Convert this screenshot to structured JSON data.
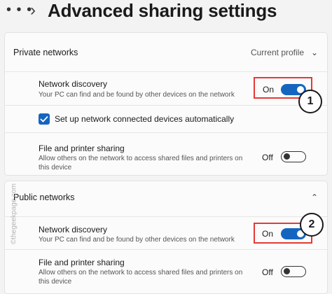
{
  "header": {
    "menu_label": "• • •",
    "title": "Advanced sharing settings"
  },
  "private": {
    "label": "Private networks",
    "profile": "Current profile",
    "discovery_title": "Network discovery",
    "discovery_desc": "Your PC can find and be found by other devices on the network",
    "discovery_state": "On",
    "auto_setup_label": "Set up network connected devices automatically",
    "auto_setup_checked": true,
    "sharing_title": "File and printer sharing",
    "sharing_desc": "Allow others on the network to access shared files and printers on this device",
    "sharing_state": "Off"
  },
  "public": {
    "label": "Public networks",
    "discovery_title": "Network discovery",
    "discovery_desc": "Your PC can find and be found by other devices on the network",
    "discovery_state": "On",
    "sharing_title": "File and printer sharing",
    "sharing_desc": "Allow others on the network to access shared files and printers on this device",
    "sharing_state": "Off"
  },
  "annotations": {
    "badge1": "1",
    "badge2": "2"
  },
  "watermark": "©thegeekpage.com",
  "colors": {
    "accent": "#1565c0",
    "highlight": "#e53935",
    "background": "#f3f3f3"
  }
}
